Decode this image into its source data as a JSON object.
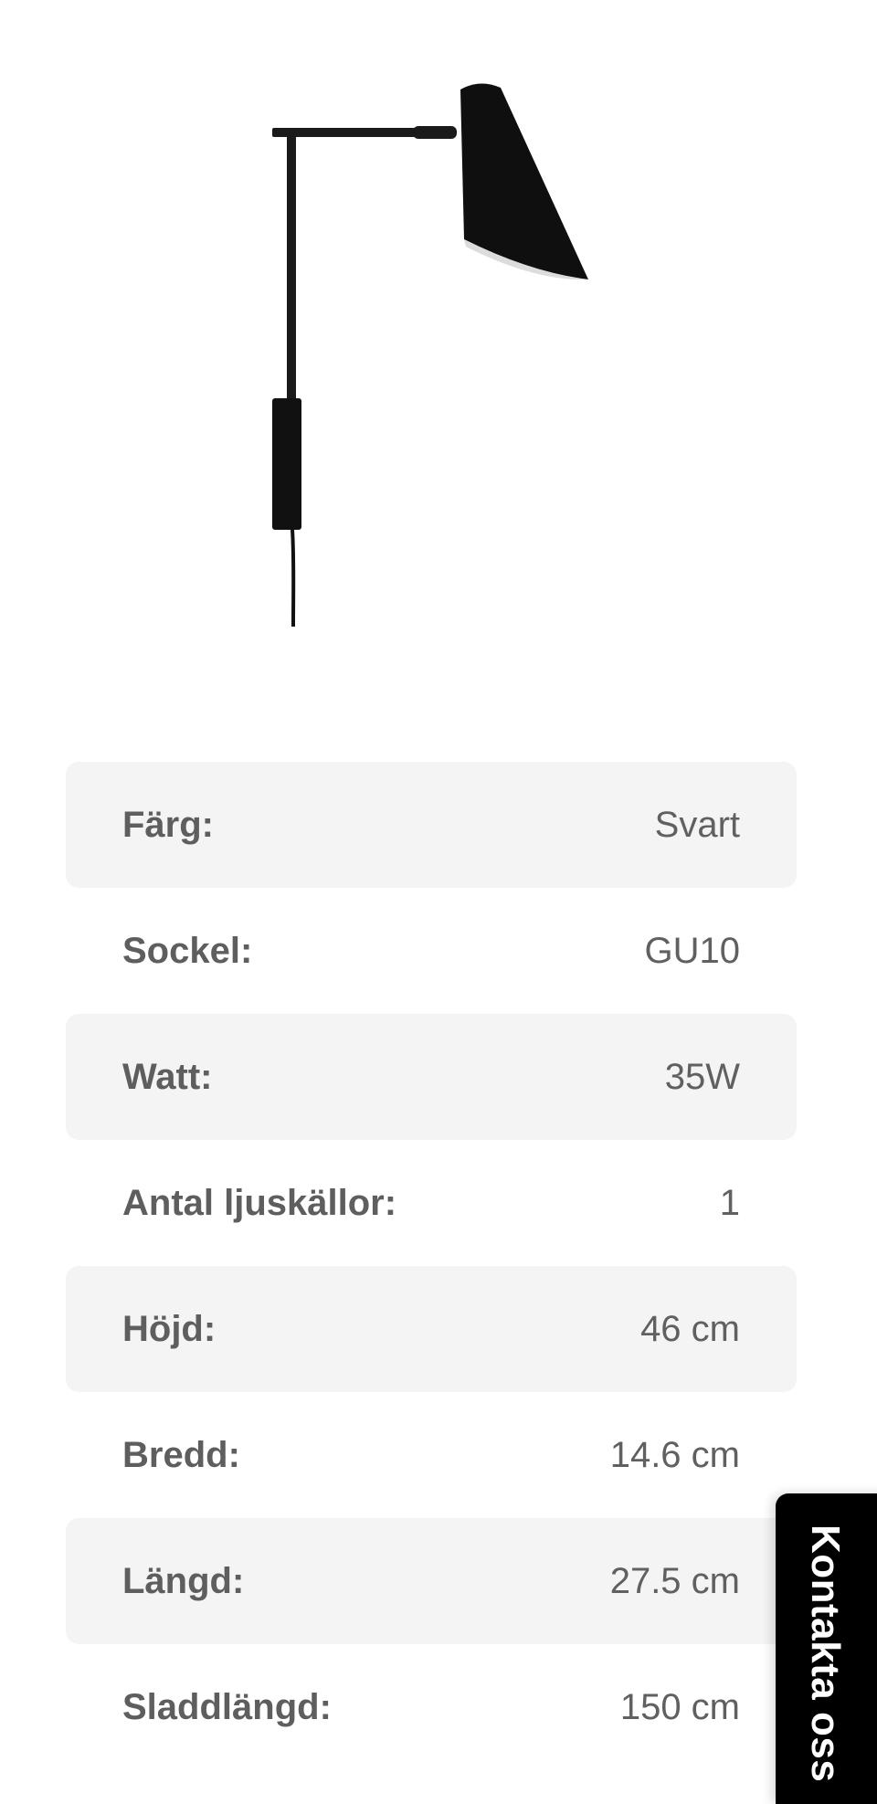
{
  "product": {
    "image_icon": "wall-lamp-image"
  },
  "specs": [
    {
      "label": "Färg:",
      "value": "Svart"
    },
    {
      "label": "Sockel:",
      "value": "GU10"
    },
    {
      "label": "Watt:",
      "value": "35W"
    },
    {
      "label": "Antal ljuskällor:",
      "value": "1"
    },
    {
      "label": "Höjd:",
      "value": "46 cm"
    },
    {
      "label": "Bredd:",
      "value": "14.6 cm"
    },
    {
      "label": "Längd:",
      "value": "27.5 cm"
    },
    {
      "label": "Sladdlängd:",
      "value": "150 cm"
    }
  ],
  "contact": {
    "label": "Kontakta oss"
  },
  "colors": {
    "row_shade": "#f4f4f4",
    "label": "#5e5e5e",
    "contact_bg": "#000000"
  }
}
